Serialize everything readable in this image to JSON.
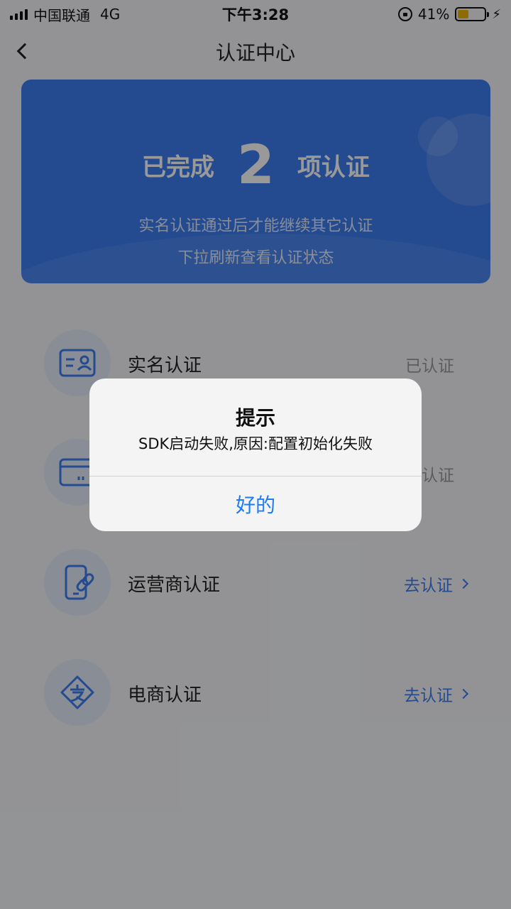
{
  "status_bar": {
    "carrier": "中国联通",
    "network": "4G",
    "time": "下午3:28",
    "battery_percent": "41%",
    "battery_level": 0.41,
    "icons": [
      "signal-icon",
      "orientation-lock-icon",
      "battery-icon",
      "charging-bolt-icon"
    ]
  },
  "nav": {
    "title": "认证中心",
    "back_icon": "chevron-left-icon"
  },
  "banner": {
    "prefix": "已完成",
    "count": "2",
    "suffix": "项认证",
    "note_1": "实名认证通过后才能继续其它认证",
    "note_2": "下拉刷新查看认证状态"
  },
  "items": [
    {
      "label": "实名认证",
      "status": "已认证",
      "icon": "id-card-icon"
    },
    {
      "label": "",
      "status": "认证",
      "icon": "bank-card-icon"
    },
    {
      "label": "运营商认证",
      "action": "去认证",
      "icon": "phone-link-icon"
    },
    {
      "label": "电商认证",
      "action": "去认证",
      "icon": "alipay-icon"
    }
  ],
  "alert": {
    "title": "提示",
    "message": "SDK启动失败,原因:配置初始化失败",
    "button": "好的"
  },
  "colors": {
    "accent": "#3d7cf0",
    "alert_button": "#1e7cf5",
    "muted": "#9a9a9a"
  }
}
